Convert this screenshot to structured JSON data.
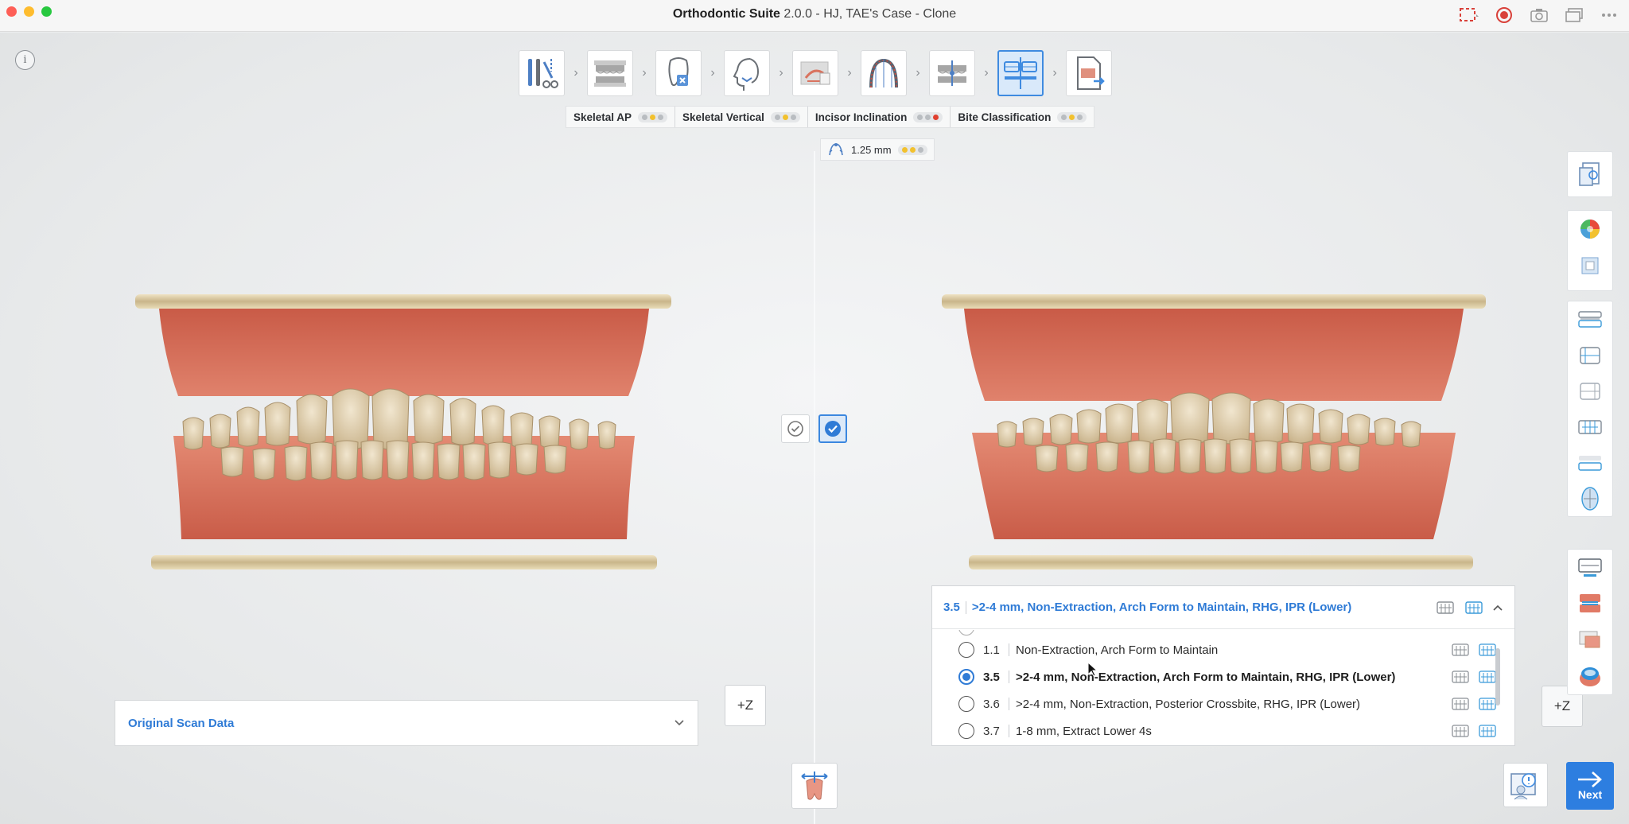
{
  "window": {
    "title_app": "Orthodontic Suite",
    "title_rest": " 2.0.0 - HJ, TAE's Case - Clone"
  },
  "info_button": {
    "label": "i"
  },
  "steps": [
    {
      "icon": "tools-icon"
    },
    {
      "icon": "scan-arches-icon"
    },
    {
      "icon": "tooth-segmentation-icon"
    },
    {
      "icon": "face-profile-icon"
    },
    {
      "icon": "cephalometric-icon"
    },
    {
      "icon": "arch-form-icon"
    },
    {
      "icon": "occlusion-icon"
    },
    {
      "icon": "treatment-options-icon",
      "active": true
    },
    {
      "icon": "report-export-icon"
    }
  ],
  "status": [
    {
      "label": "Skeletal AP",
      "dots": [
        "grey",
        "yellow",
        "grey"
      ]
    },
    {
      "label": "Skeletal Vertical",
      "dots": [
        "grey",
        "yellow",
        "grey"
      ]
    },
    {
      "label": "Incisor Inclination",
      "dots": [
        "grey",
        "grey",
        "red"
      ]
    },
    {
      "label": "Bite Classification",
      "dots": [
        "grey",
        "yellow",
        "grey"
      ]
    }
  ],
  "measure": {
    "value": "1.25 mm",
    "dots": [
      "yellow",
      "yellow",
      "grey"
    ]
  },
  "scan_panel": {
    "label": "Original Scan Data"
  },
  "z_label": "+Z",
  "option_panel": {
    "selected_num": "3.5",
    "selected_text": ">2-4 mm, Non-Extraction, Arch Form to Maintain, RHG, IPR (Lower)",
    "rows": [
      {
        "num": "1.1",
        "text": "Non-Extraction, Arch Form to Maintain",
        "selected": false
      },
      {
        "num": "3.5",
        "text": ">2-4 mm, Non-Extraction, Arch Form to Maintain, RHG, IPR (Lower)",
        "selected": true
      },
      {
        "num": "3.6",
        "text": ">2-4 mm, Non-Extraction, Posterior Crossbite, RHG, IPR (Lower)",
        "selected": false
      },
      {
        "num": "3.7",
        "text": "1-8 mm, Extract Lower 4s",
        "selected": false
      }
    ]
  },
  "next_button": {
    "label": "Next"
  },
  "colors": {
    "accent": "#2d7ee0",
    "gum": "#d9735f",
    "tooth": "#e9d9bf",
    "base": "#d8c9a0"
  }
}
